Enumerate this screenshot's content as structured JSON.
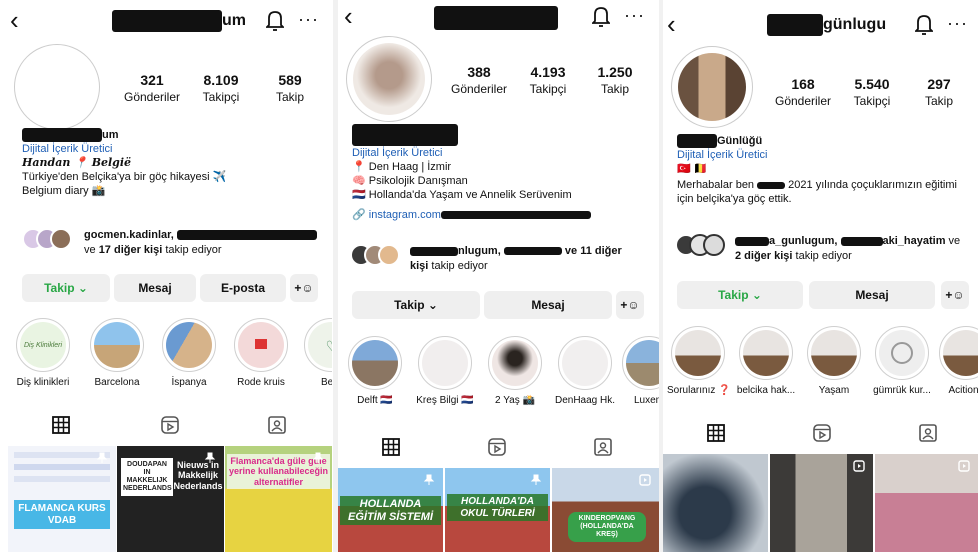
{
  "profiles": [
    {
      "username_suffix": "um",
      "stats": [
        {
          "value": "321",
          "label": "Gönderiler"
        },
        {
          "value": "8.109",
          "label": "Takipçi"
        },
        {
          "value": "589",
          "label": "Takip"
        }
      ],
      "name_suffix": "um",
      "category": "Dijital İçerik Üretici",
      "bio_lines": [
        "Handan 📍 België",
        "Türkiye'den Belçika'ya bir göç hikayesi ✈️",
        "Belgium diary 📸"
      ],
      "followed_by_line1": "gocmen.kadinlar,",
      "followed_by_line2_prefix": "ve ",
      "followed_by_line2_bold": "17 diğer kişi",
      "followed_by_line2_suffix": " takip ediyor",
      "buttons": [
        "Takip ⌄",
        "Mesaj",
        "E-posta"
      ],
      "highlights": [
        "Diş klinikleri",
        "Barcelona",
        "İspanya",
        "Rode kruis",
        "Belg"
      ],
      "highlight_inner_text": "Diş Klinikleri",
      "posts": [
        "FLAMANCA KURS VDAB",
        "Nieuws in Makkelijk Nederlands",
        "Flamanca'da güle güle yerine kullanabileceğin alternatifler"
      ],
      "post2_sub": "DOUDAPAN IN MAKKELIJK NEDERLANDS"
    },
    {
      "stats": [
        {
          "value": "388",
          "label": "Gönderiler"
        },
        {
          "value": "4.193",
          "label": "Takipçi"
        },
        {
          "value": "1.250",
          "label": "Takip"
        }
      ],
      "category": "Dijital İçerik Üretici",
      "bio_lines": [
        "📍 Den Haag | İzmir",
        "🧠 Psikolojik Danışman",
        "🇳🇱 Hollanda'da Yaşam ve Annelik Serüvenim"
      ],
      "link": "instagram.com",
      "followed_by_mid": "nlugum,",
      "followed_by_tail": " ve 11 diğer",
      "followed_by_line2_bold": "kişi",
      "followed_by_line2_suffix": " takip ediyor",
      "buttons": [
        "Takip ⌄",
        "Mesaj"
      ],
      "highlights": [
        "Delft 🇳🇱",
        "Kreş Bilgi 🇳🇱",
        "2 Yaş 📸",
        "DenHaag Hk.",
        "Luxem"
      ],
      "posts": [
        "HOLLANDA EĞİTİM SİSTEMİ",
        "HOLLANDA'DA OKUL TÜRLERİ",
        "KINDEROPVANG (HOLLANDA'DA KREŞ)"
      ]
    },
    {
      "username_suffix": "günlugu",
      "stats": [
        {
          "value": "168",
          "label": "Gönderiler"
        },
        {
          "value": "5.540",
          "label": "Takipçi"
        },
        {
          "value": "297",
          "label": "Takip"
        }
      ],
      "name_suffix": "Günlüğü",
      "category": "Dijital İçerik Üretici",
      "flags": "🇹🇷 🇧🇪",
      "bio_line1_prefix": "Merhabalar ben",
      "bio_line1_suffix": " 2021 yılında çoçuklarımızın eğitimi",
      "bio_line2": "için belçika'ya göç ettik.",
      "followed_by_a": "a_gunlugum,",
      "followed_by_b": "aki_hayatim",
      "followed_by_c": " ve",
      "followed_by_line2_bold": "2 diğer kişi",
      "followed_by_line2_suffix": " takip ediyor",
      "buttons": [
        "Takip ⌄",
        "Mesaj"
      ],
      "highlights": [
        "Sorularınız ❓",
        "belcika hak...",
        "Yaşam",
        "gümrük kur...",
        "Acitions"
      ]
    }
  ],
  "icons": [
    "back-icon",
    "bell-icon",
    "more-icon",
    "add-person-icon",
    "grid-icon",
    "reels-icon",
    "tagged-icon",
    "pin-icon"
  ],
  "colors": {
    "green": "#28a745",
    "link": "#1f5fb5",
    "button_bg": "#efefef",
    "redact": "#111111"
  }
}
